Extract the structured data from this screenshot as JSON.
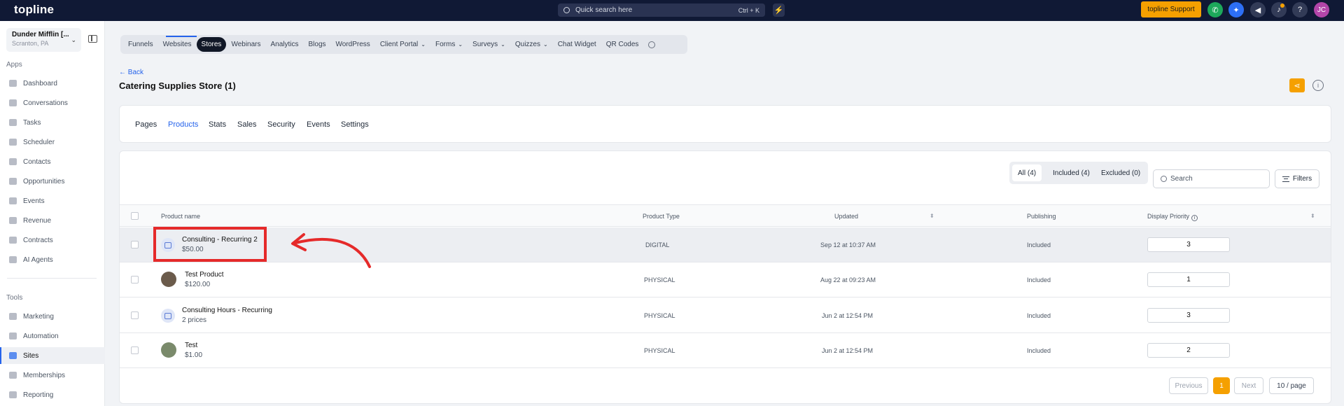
{
  "app": {
    "logo": "topline",
    "search_placeholder": "Quick search here",
    "search_shortcut": "Ctrl + K",
    "support_label": "topline Support",
    "avatar_initials": "JC",
    "accent_color": "#f5a000"
  },
  "sidebar": {
    "location_name": "Dunder Mifflin [...",
    "location_sub": "Scranton, PA",
    "apps_label": "Apps",
    "tools_label": "Tools",
    "apps": [
      {
        "label": "Dashboard"
      },
      {
        "label": "Conversations"
      },
      {
        "label": "Tasks"
      },
      {
        "label": "Scheduler"
      },
      {
        "label": "Contacts"
      },
      {
        "label": "Opportunities"
      },
      {
        "label": "Events"
      },
      {
        "label": "Revenue"
      },
      {
        "label": "Contracts"
      },
      {
        "label": "AI Agents"
      }
    ],
    "tools": [
      {
        "label": "Marketing"
      },
      {
        "label": "Automation"
      },
      {
        "label": "Sites"
      },
      {
        "label": "Memberships"
      },
      {
        "label": "Reporting"
      }
    ]
  },
  "topnav": [
    {
      "label": "Funnels"
    },
    {
      "label": "Websites"
    },
    {
      "label": "Stores"
    },
    {
      "label": "Webinars"
    },
    {
      "label": "Analytics"
    },
    {
      "label": "Blogs"
    },
    {
      "label": "WordPress"
    },
    {
      "label": "Client Portal"
    },
    {
      "label": "Forms"
    },
    {
      "label": "Surveys"
    },
    {
      "label": "Quizzes"
    },
    {
      "label": "Chat Widget"
    },
    {
      "label": "QR Codes"
    }
  ],
  "page": {
    "back_label": "← Back",
    "title": "Catering Supplies Store (1)"
  },
  "tabs": [
    {
      "label": "Pages"
    },
    {
      "label": "Products"
    },
    {
      "label": "Stats"
    },
    {
      "label": "Sales"
    },
    {
      "label": "Security"
    },
    {
      "label": "Events"
    },
    {
      "label": "Settings"
    }
  ],
  "products": {
    "filters_seg": [
      {
        "label": "All (4)"
      },
      {
        "label": "Included (4)"
      },
      {
        "label": "Excluded (0)"
      }
    ],
    "search_placeholder": "Search",
    "filters_label": "Filters",
    "columns": {
      "name": "Product name",
      "type": "Product Type",
      "updated": "Updated",
      "publishing": "Publishing",
      "priority": "Display Priority"
    },
    "rows": [
      {
        "name": "Consulting - Recurring 2",
        "price": "$50.00",
        "type": "DIGITAL",
        "updated": "Sep 12 at 10:37 AM",
        "publishing": "Included",
        "priority": "3"
      },
      {
        "name": "Test Product",
        "price": "$120.00",
        "type": "PHYSICAL",
        "updated": "Aug 22 at 09:23 AM",
        "publishing": "Included",
        "priority": "1"
      },
      {
        "name": "Consulting Hours - Recurring",
        "price": "2 prices",
        "type": "PHYSICAL",
        "updated": "Jun 2 at 12:54 PM",
        "publishing": "Included",
        "priority": "3"
      },
      {
        "name": "Test",
        "price": "$1.00",
        "type": "PHYSICAL",
        "updated": "Jun 2 at 12:54 PM",
        "publishing": "Included",
        "priority": "2"
      }
    ]
  },
  "pagination": {
    "previous": "Previous",
    "current": "1",
    "next": "Next",
    "per_page": "10 / page"
  }
}
